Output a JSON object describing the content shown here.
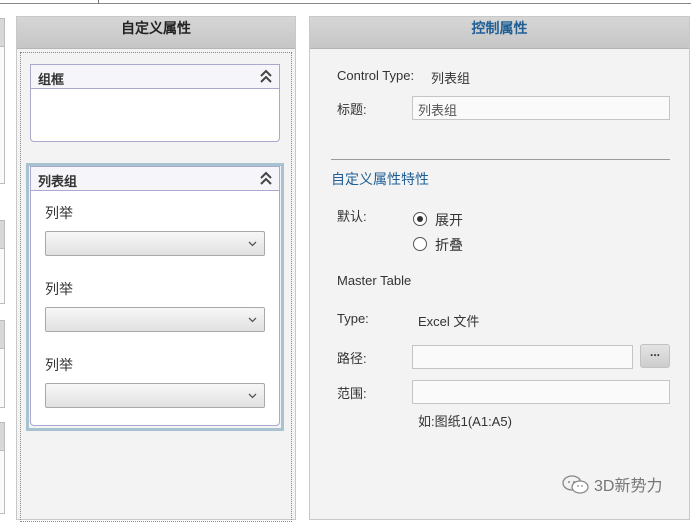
{
  "middle_panel": {
    "title": "自定义属性",
    "group_frame": {
      "title": "组框"
    },
    "list_group": {
      "title": "列表组",
      "items": [
        {
          "label": "列举",
          "value": ""
        },
        {
          "label": "列举",
          "value": ""
        },
        {
          "label": "列举",
          "value": ""
        }
      ]
    }
  },
  "right_panel": {
    "title": "控制属性",
    "control_type_label": "Control Type:",
    "control_type_value": "列表组",
    "title_label": "标题:",
    "title_value": "列表组",
    "section_title": "自定义属性特性",
    "default_label": "默认:",
    "radio_expand": {
      "label": "展开",
      "checked": true
    },
    "radio_collapse": {
      "label": "折叠",
      "checked": false
    },
    "master_table_label": "Master Table",
    "type_label": "Type:",
    "type_value": "Excel 文件",
    "path_label": "路径:",
    "path_value": "",
    "browse_label": "...",
    "range_label": "范围:",
    "range_value": "",
    "range_hint": "如:图纸1(A1:A5)"
  },
  "watermark": {
    "text": "3D新势力",
    "icon": "wechat-icon"
  }
}
